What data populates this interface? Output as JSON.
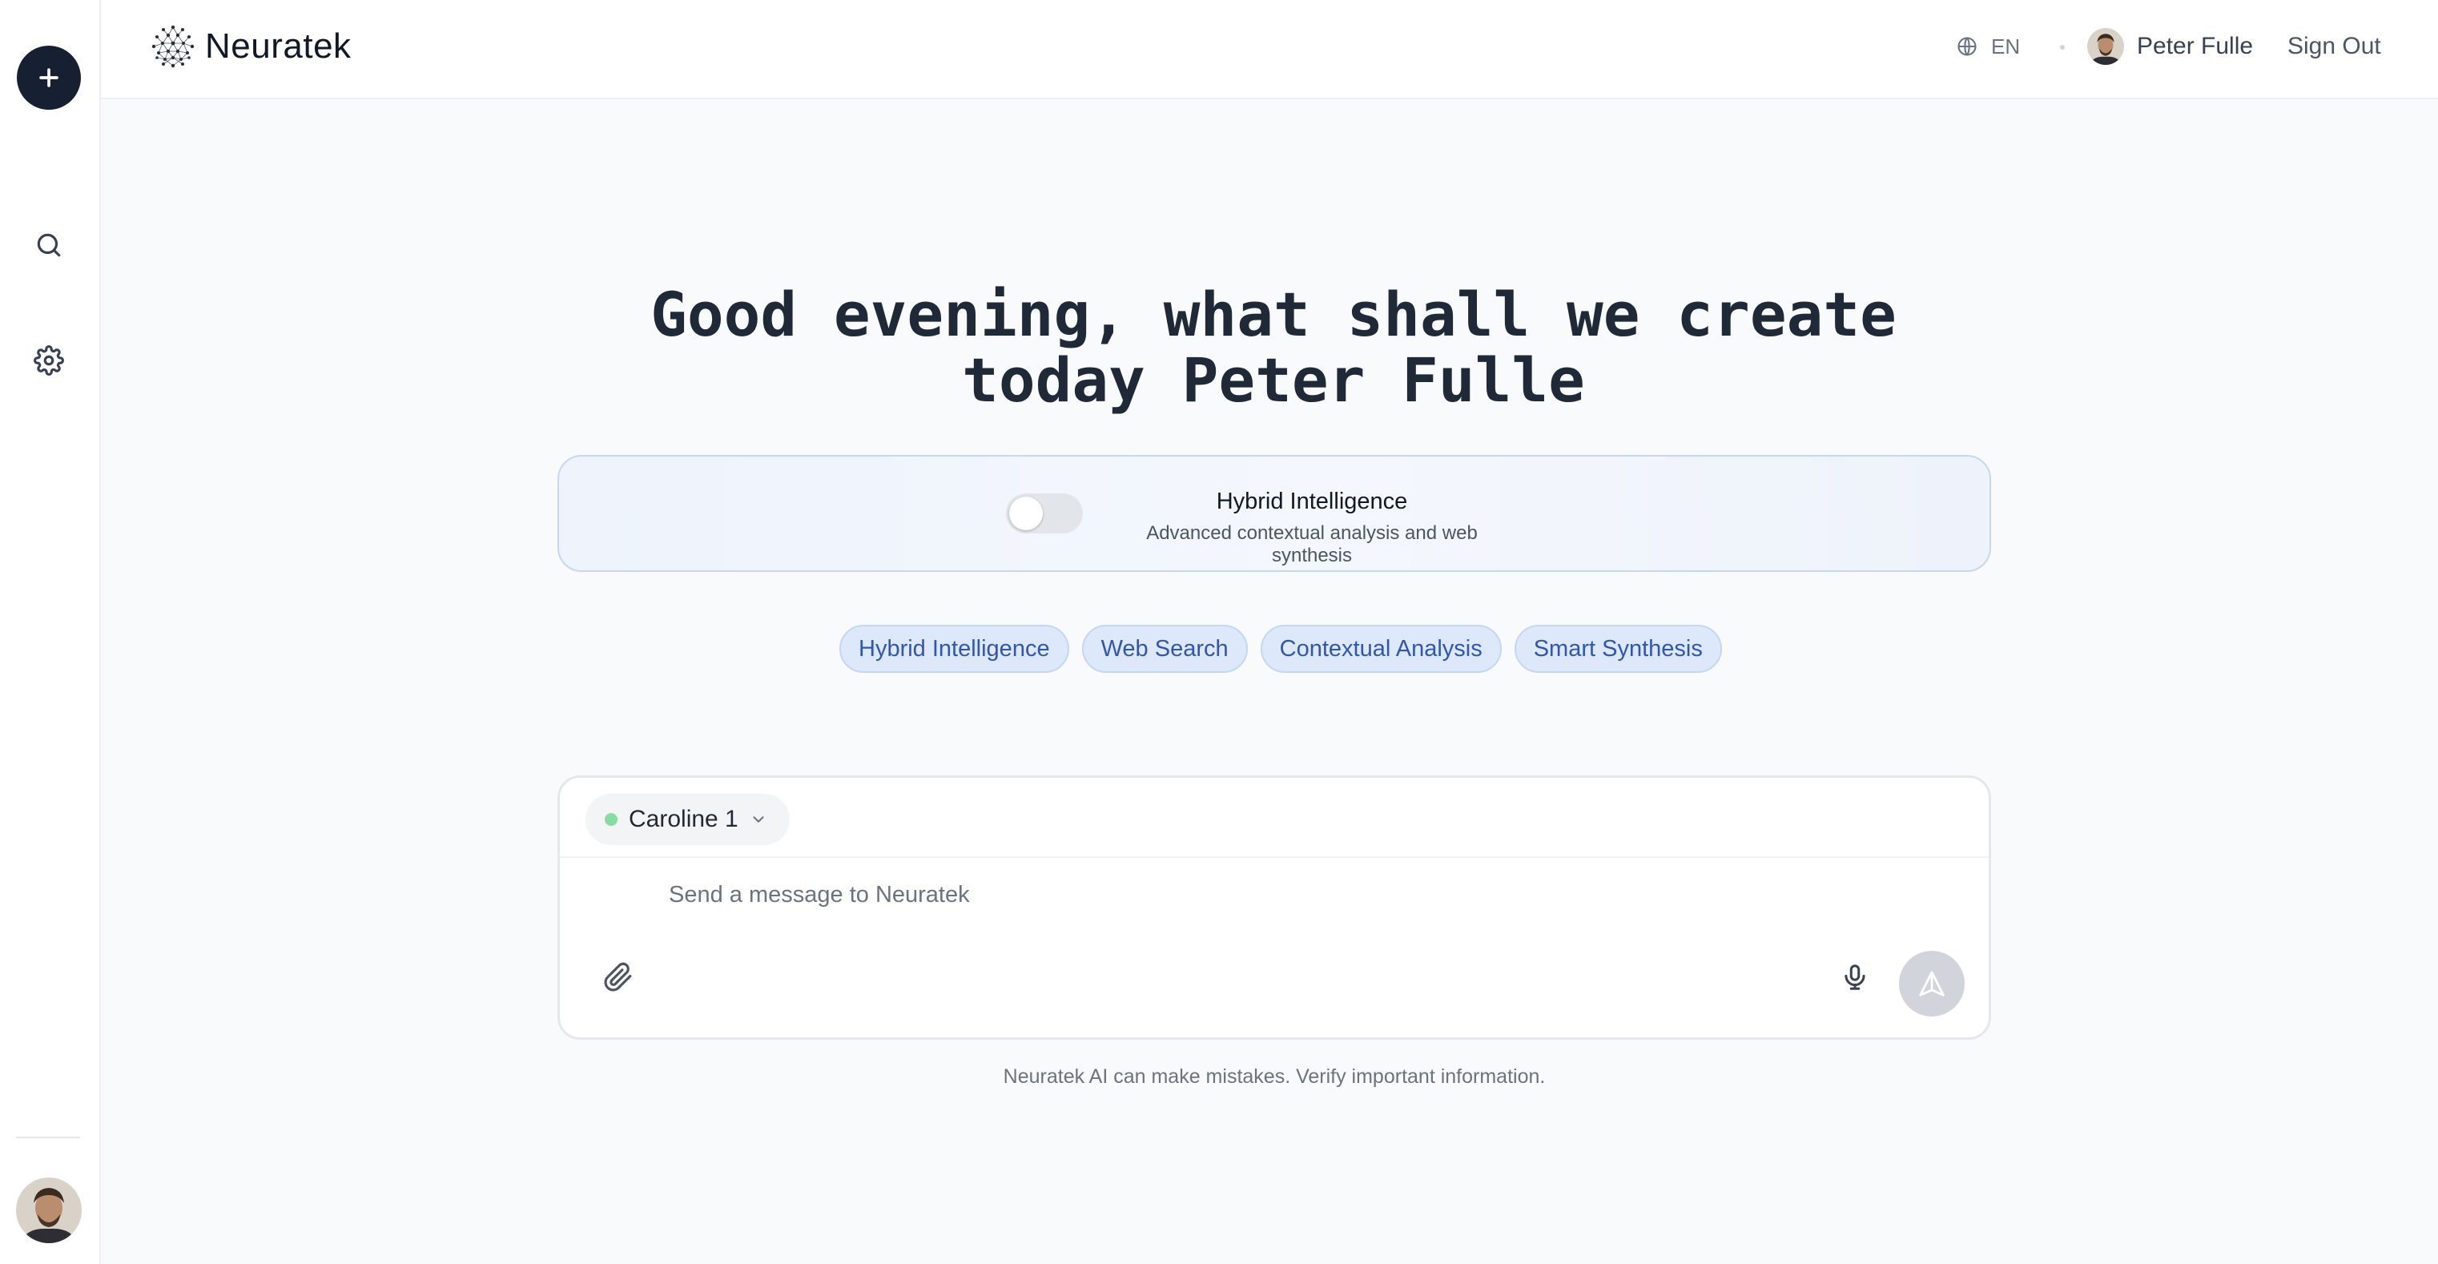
{
  "header": {
    "brand": "Neuratek",
    "language": "EN",
    "user_name": "Peter Fulle",
    "sign_out": "Sign Out"
  },
  "sidebar": {
    "icons": [
      "plus-icon",
      "search-icon",
      "gear-icon",
      "avatar"
    ]
  },
  "main": {
    "greeting_line1": "Good evening, what shall we create",
    "greeting_line2": "today Peter Fulle",
    "hybrid": {
      "title": "Hybrid Intelligence",
      "subtitle": "Advanced contextual analysis and web synthesis",
      "enabled": false
    },
    "chips": [
      "Hybrid Intelligence",
      "Web Search",
      "Contextual Analysis",
      "Smart Synthesis"
    ],
    "composer": {
      "model": "Caroline 1",
      "model_status_color": "#86dca2",
      "placeholder": "Send a message to Neuratek"
    },
    "disclaimer": "Neuratek AI can make mistakes. Verify important information."
  },
  "colors": {
    "accent_dark": "#172033",
    "chip_text": "#2f56b5",
    "chip_bg": "#dde8fb"
  }
}
